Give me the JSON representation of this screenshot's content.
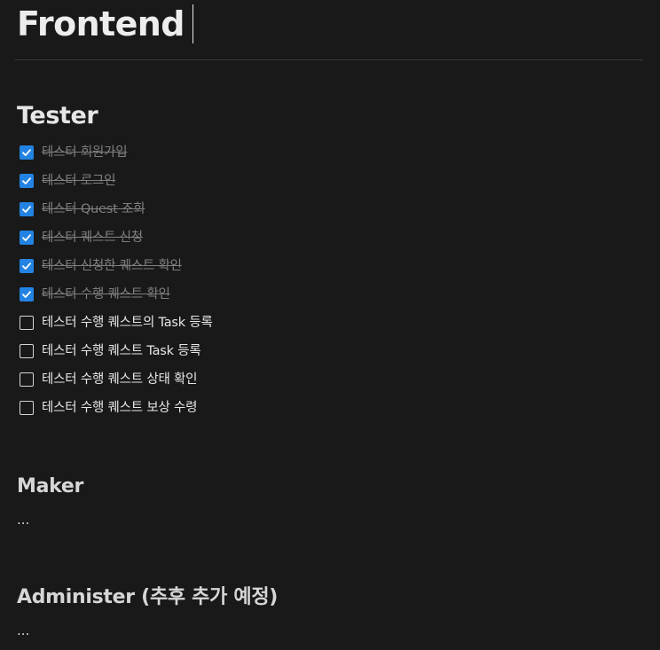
{
  "page": {
    "title": "Frontend"
  },
  "sections": {
    "tester": {
      "heading": "Tester",
      "todos": [
        {
          "label": "테스터 회원가입",
          "checked": true
        },
        {
          "label": "테스터 로그인",
          "checked": true
        },
        {
          "label": "테스터 Quest 조회",
          "checked": true
        },
        {
          "label": "테스터 퀘스트 신청",
          "checked": true
        },
        {
          "label": "테스터 신청한 퀘스트 확인",
          "checked": true
        },
        {
          "label": "테스터 수행 퀘스트 확인",
          "checked": true
        },
        {
          "label": "테스터 수행 퀘스트의 Task 등록",
          "checked": false
        },
        {
          "label": "테스터 수행 퀘스트 Task 등록",
          "checked": false
        },
        {
          "label": "테스터 수행 퀘스트 상태 확인",
          "checked": false
        },
        {
          "label": "테스터 수행 퀘스트 보상 수령",
          "checked": false
        }
      ]
    },
    "maker": {
      "heading": "Maker",
      "body": "..."
    },
    "administer": {
      "heading": "Administer (추후 추가 예정)",
      "body": "..."
    }
  },
  "colors": {
    "background": "#191919",
    "checkbox_accent": "#2383e2",
    "done_text": "#7f7f7f",
    "text": "#e6e6e6"
  },
  "icons": {
    "checked": "checkmark-icon",
    "unchecked": "empty-checkbox-icon"
  }
}
